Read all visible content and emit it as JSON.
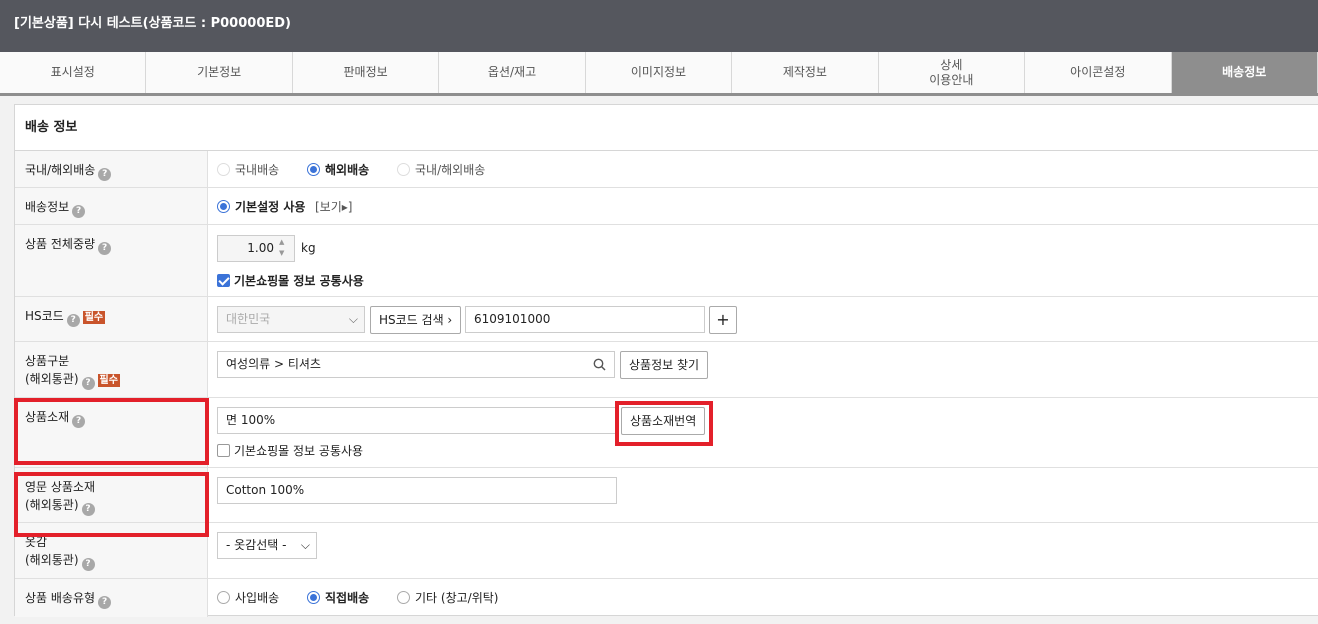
{
  "header": {
    "title": "[기본상품] 다시 테스트(상품코드 : P00000ED)"
  },
  "tabs": [
    {
      "label": "표시설정"
    },
    {
      "label": "기본정보"
    },
    {
      "label": "판매정보"
    },
    {
      "label": "옵션/재고"
    },
    {
      "label": "이미지정보"
    },
    {
      "label": "제작정보"
    },
    {
      "label": "상세\n이용안내"
    },
    {
      "label": "아이콘설정"
    },
    {
      "label": "배송정보"
    }
  ],
  "section": {
    "title": "배송 정보"
  },
  "fields": {
    "delivery_scope": {
      "label": "국내/해외배송",
      "options": [
        "국내배송",
        "해외배송",
        "국내/해외배송"
      ],
      "selected": "해외배송"
    },
    "shipping_info": {
      "label": "배송정보",
      "option": "기본설정 사용",
      "view_link": "[보기▸]"
    },
    "weight": {
      "label": "상품 전체중량",
      "value": "1.00",
      "unit": "kg",
      "checkbox_label": "기본쇼핑몰 정보 공통사용",
      "checked": true
    },
    "hscode": {
      "label": "HS코드",
      "required": "필수",
      "country": "대한민국",
      "search_button": "HS코드 검색 ›",
      "code": "6109101000",
      "add": "+"
    },
    "category": {
      "label_line1": "상품구분",
      "label_line2": "(해외통관)",
      "required": "필수",
      "value": "여성의류 > 티셔츠",
      "find_button": "상품정보 찾기"
    },
    "material": {
      "label": "상품소재",
      "value": "면 100%",
      "translate_button": "상품소재번역",
      "checkbox_label": "기본쇼핑몰 정보 공통사용",
      "checked": false
    },
    "material_en": {
      "label_line1": "영문 상품소재",
      "label_line2": "(해외통관)",
      "value": "Cotton 100%"
    },
    "fabric": {
      "label_line1": "옷감",
      "label_line2": "(해외통관)",
      "select": "- 옷감선택 -"
    },
    "ship_type": {
      "label": "상품 배송유형",
      "options": [
        "사입배송",
        "직접배송",
        "기타 (창고/위탁)"
      ],
      "selected": "직접배송"
    }
  },
  "icons": {
    "help": "?",
    "search": "search-icon",
    "dropdown": "chevron-down-icon"
  },
  "colors": {
    "highlight": "#e3202a",
    "accent": "#3b73d8",
    "header": "#55575e",
    "active_tab": "#8e8e8e"
  }
}
